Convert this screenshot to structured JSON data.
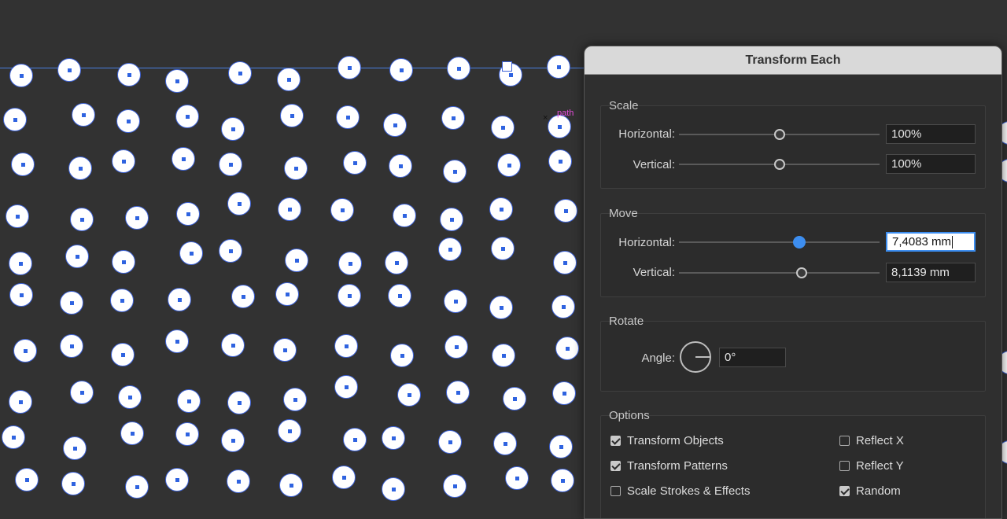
{
  "canvas": {
    "path_label": "path",
    "cursor_glyph": "×",
    "accent_color": "#3f64d8",
    "background_color": "#323232"
  },
  "dialog": {
    "title": "Transform Each",
    "scale": {
      "title": "Scale",
      "horizontal_label": "Horizontal:",
      "horizontal_value": "100%",
      "horizontal_slider": 0.5,
      "vertical_label": "Vertical:",
      "vertical_value": "100%",
      "vertical_slider": 0.5
    },
    "move": {
      "title": "Move",
      "horizontal_label": "Horizontal:",
      "horizontal_value": "7,4083 mm",
      "horizontal_slider": 0.6,
      "vertical_label": "Vertical:",
      "vertical_value": "8,1139 mm",
      "vertical_slider": 0.61
    },
    "rotate": {
      "title": "Rotate",
      "angle_label": "Angle:",
      "angle_value": "0°"
    },
    "options": {
      "title": "Options",
      "transform_objects": {
        "label": "Transform Objects",
        "checked": true
      },
      "transform_patterns": {
        "label": "Transform Patterns",
        "checked": true
      },
      "scale_strokes": {
        "label": "Scale Strokes & Effects",
        "checked": false
      },
      "reflect_x": {
        "label": "Reflect X",
        "checked": false
      },
      "reflect_y": {
        "label": "Reflect Y",
        "checked": false
      },
      "random": {
        "label": "Random",
        "checked": true
      }
    }
  }
}
